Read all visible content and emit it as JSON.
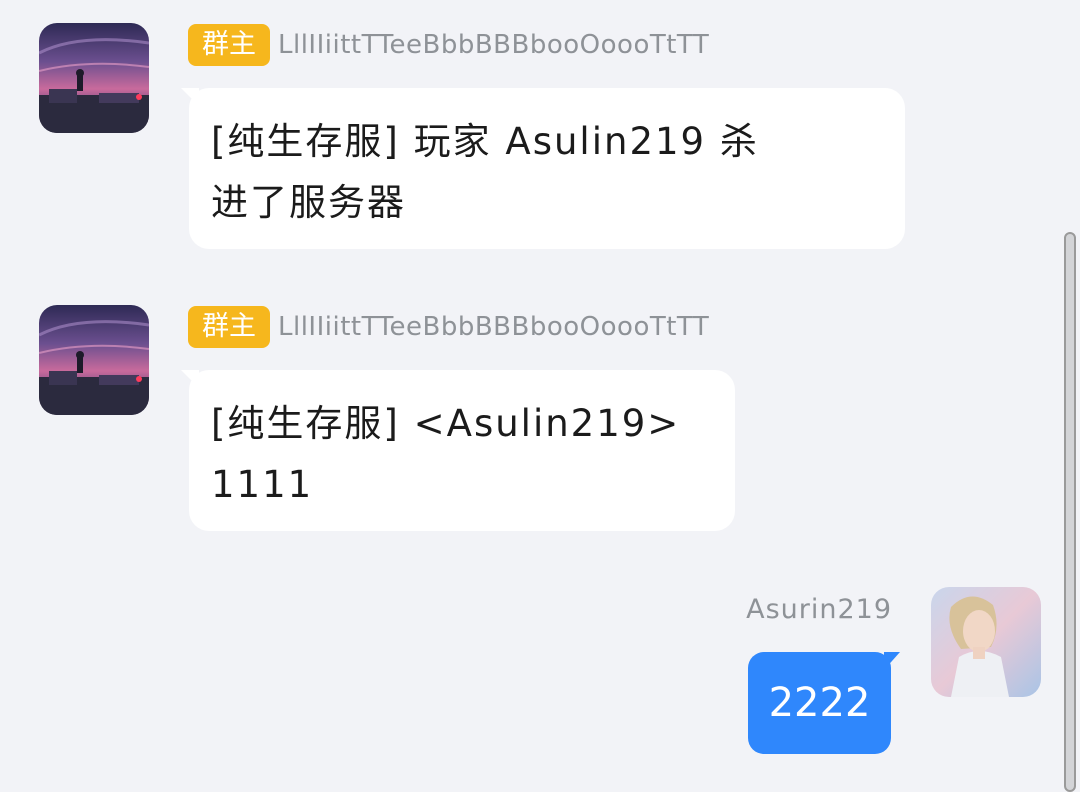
{
  "messages": [
    {
      "badge": "群主",
      "nickname": "LllIIiittTTeeBbbBBBbooOoooTtTT",
      "lines": [
        "[纯生存服] 玩家 Asulin219 杀",
        "进了服务器"
      ]
    },
    {
      "badge": "群主",
      "nickname": "LllIIiittTTeeBbbBBBbooOoooTtTT",
      "lines": [
        "[纯生存服] <Asulin219>",
        "1111"
      ]
    }
  ],
  "self": {
    "name": "Asurin219",
    "text": "2222"
  },
  "colors": {
    "background": "#f2f3f7",
    "badge": "#f6b71d",
    "self_bubble": "#2f87fc",
    "other_bubble": "#ffffff"
  }
}
